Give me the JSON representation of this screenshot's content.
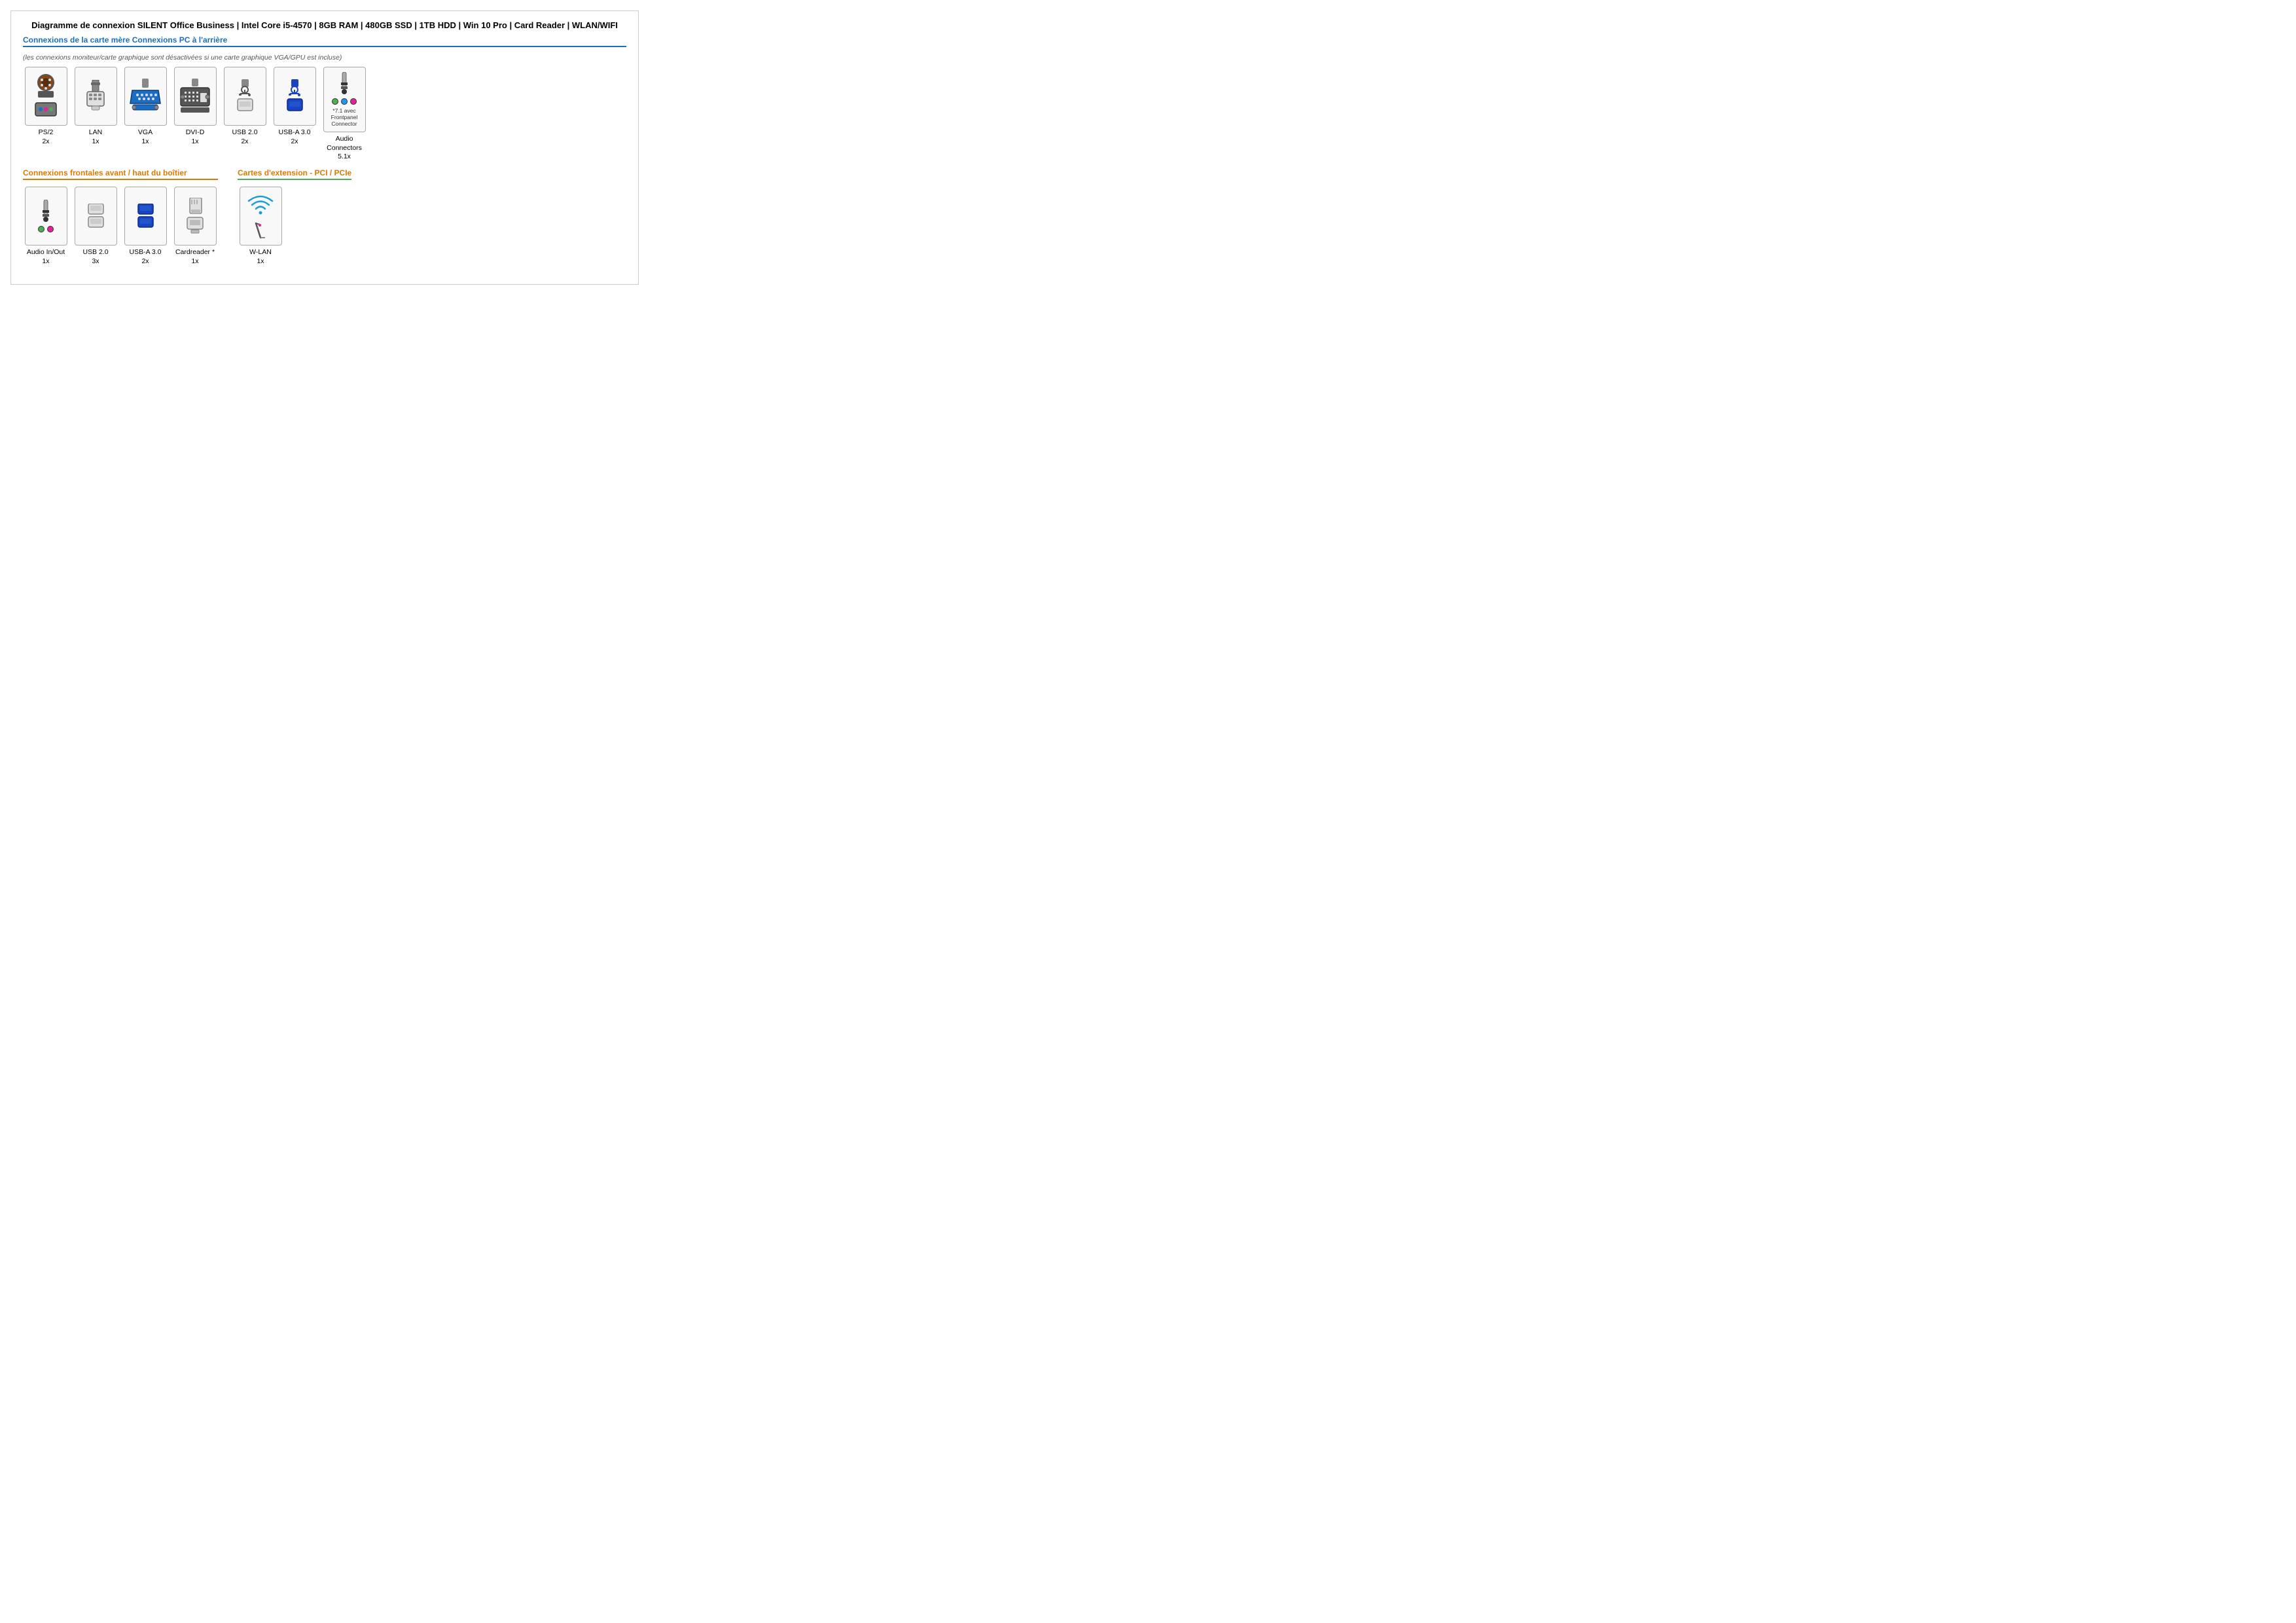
{
  "page": {
    "title": "Diagramme de connexion SILENT Office Business | Intel Core i5-4570 | 8GB RAM | 480GB SSD | 1TB HDD | Win 10 Pro | Card Reader | WLAN/WIFI",
    "section1_title": "Connexions de la carte mère Connexions PC à l'arrière",
    "section1_subtitle": "(les connexions moniteur/carte graphique sont désactivées si une carte graphique VGA/GPU est incluse)",
    "section2_title": "Connexions frontales avant / haut du boîtier",
    "section3_title": "Cartes d'extension - PCI / PCIe",
    "back_connectors": [
      {
        "id": "ps2",
        "label": "PS/2",
        "quantity": "2x"
      },
      {
        "id": "lan",
        "label": "LAN",
        "quantity": "1x"
      },
      {
        "id": "vga",
        "label": "VGA",
        "quantity": "1x"
      },
      {
        "id": "dvid",
        "label": "DVI-D",
        "quantity": "1x"
      },
      {
        "id": "usb2",
        "label": "USB 2.0",
        "quantity": "2x"
      },
      {
        "id": "usba3",
        "label": "USB-A 3.0",
        "quantity": "2x"
      },
      {
        "id": "audio",
        "label": "Audio Connectors",
        "quantity": "5.1x",
        "note": "*7.1 avec Frontpanel Connector"
      }
    ],
    "front_connectors": [
      {
        "id": "audio_front",
        "label": "Audio In/Out",
        "quantity": "1x"
      },
      {
        "id": "usb2_front",
        "label": "USB 2.0",
        "quantity": "3x"
      },
      {
        "id": "usba3_front",
        "label": "USB-A 3.0",
        "quantity": "2x"
      },
      {
        "id": "cardreader",
        "label": "Cardreader *",
        "quantity": "1x"
      }
    ],
    "pci_connectors": [
      {
        "id": "wlan",
        "label": "W-LAN",
        "quantity": "1x"
      }
    ]
  }
}
